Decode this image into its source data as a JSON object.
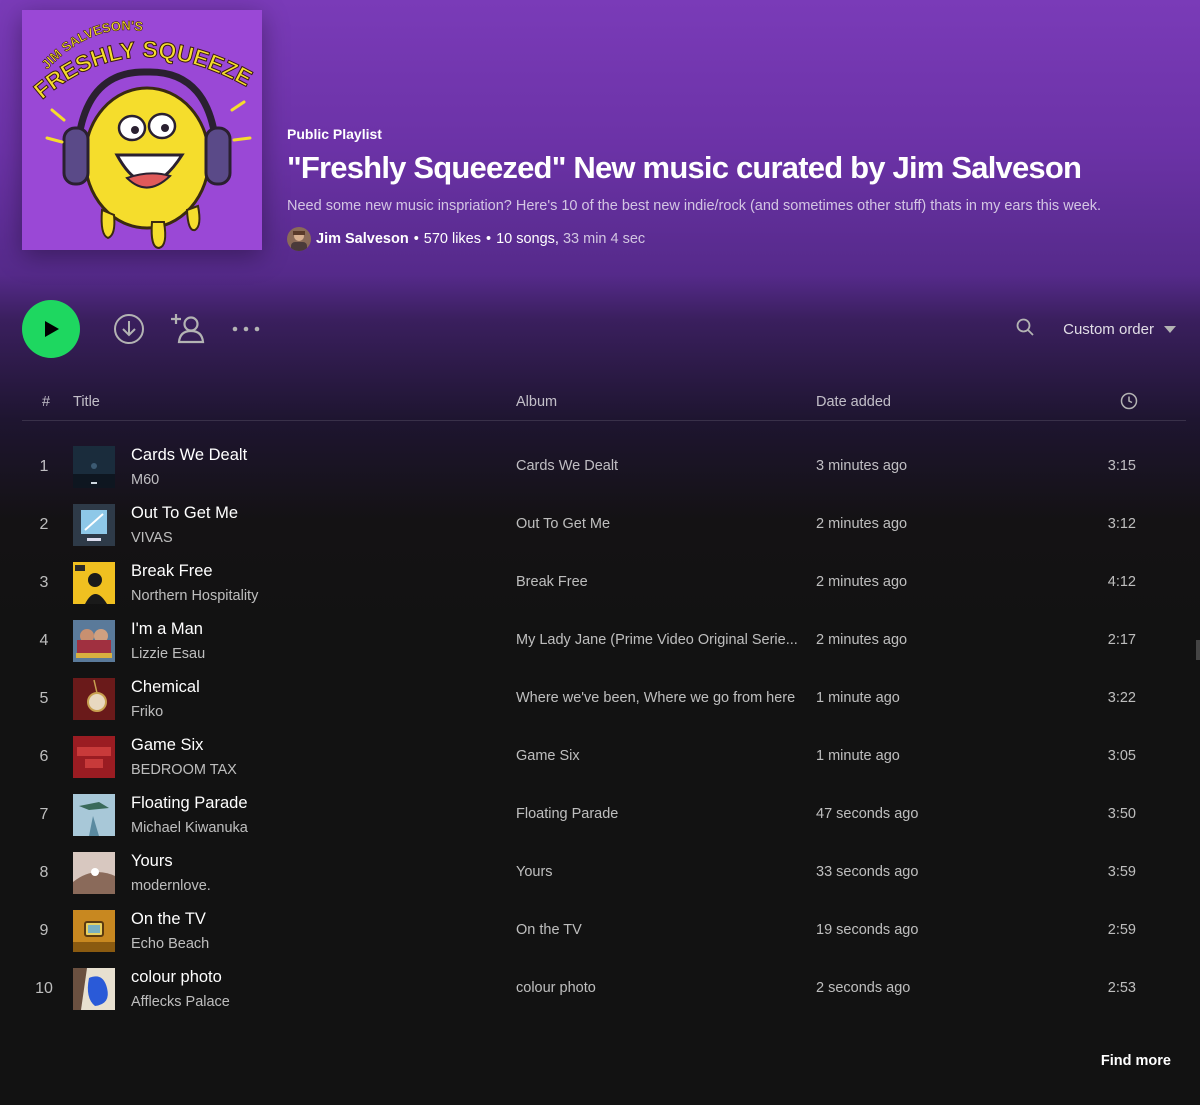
{
  "playlist": {
    "type_label": "Public Playlist",
    "title": "\"Freshly Squeezed\" New music curated by Jim Salveson",
    "description": "Need some new music inspriation? Here's 10 of the best new indie/rock (and sometimes other stuff) thats in my ears this week.",
    "owner": "Jim Salveson",
    "likes": "570 likes",
    "songs": "10 songs,",
    "duration": "33 min 4 sec",
    "separator": "•",
    "cover": {
      "line1": "JIM SALVESON'S",
      "line2": "FRESHLY SQUEEZED",
      "background": "#9a48d6",
      "lemon_color": "#f5dd2c"
    }
  },
  "toolbar": {
    "play_icon": "play-icon",
    "download_icon": "download-icon",
    "add_user_icon": "add-user-icon",
    "more_icon": "more-icon",
    "search_icon": "search-icon",
    "sort_label": "Custom order",
    "sort_icon": "caret-down-icon",
    "accent": "#1ed760"
  },
  "table": {
    "headers": {
      "number": "#",
      "title": "Title",
      "album": "Album",
      "date_added": "Date added",
      "duration_icon": "clock-icon"
    },
    "tracks": [
      {
        "n": "1",
        "title": "Cards We Dealt",
        "artist": "M60",
        "album": "Cards We Dealt",
        "added": "3 minutes ago",
        "duration": "3:15"
      },
      {
        "n": "2",
        "title": "Out To Get Me",
        "artist": "VIVAS",
        "album": "Out To Get Me",
        "added": "2 minutes ago",
        "duration": "3:12"
      },
      {
        "n": "3",
        "title": "Break Free",
        "artist": "Northern Hospitality",
        "album": "Break Free",
        "added": "2 minutes ago",
        "duration": "4:12"
      },
      {
        "n": "4",
        "title": "I'm a Man",
        "artist": "Lizzie Esau",
        "album": "My Lady Jane (Prime Video Original Serie...",
        "added": "2 minutes ago",
        "duration": "2:17"
      },
      {
        "n": "5",
        "title": "Chemical",
        "artist": "Friko",
        "album": "Where we've been, Where we go from here",
        "added": "1 minute ago",
        "duration": "3:22"
      },
      {
        "n": "6",
        "title": "Game Six",
        "artist": "BEDROOM TAX",
        "album": "Game Six",
        "added": "1 minute ago",
        "duration": "3:05"
      },
      {
        "n": "7",
        "title": "Floating Parade",
        "artist": "Michael Kiwanuka",
        "album": "Floating Parade",
        "added": "47 seconds ago",
        "duration": "3:50"
      },
      {
        "n": "8",
        "title": "Yours",
        "artist": "modernlove.",
        "album": "Yours",
        "added": "33 seconds ago",
        "duration": "3:59"
      },
      {
        "n": "9",
        "title": "On the TV",
        "artist": "Echo Beach",
        "album": "On the TV",
        "added": "19 seconds ago",
        "duration": "2:59"
      },
      {
        "n": "10",
        "title": "colour photo",
        "artist": "Afflecks Palace",
        "album": "colour photo",
        "added": "2 seconds ago",
        "duration": "2:53"
      }
    ]
  },
  "footer": {
    "find_more": "Find more"
  }
}
